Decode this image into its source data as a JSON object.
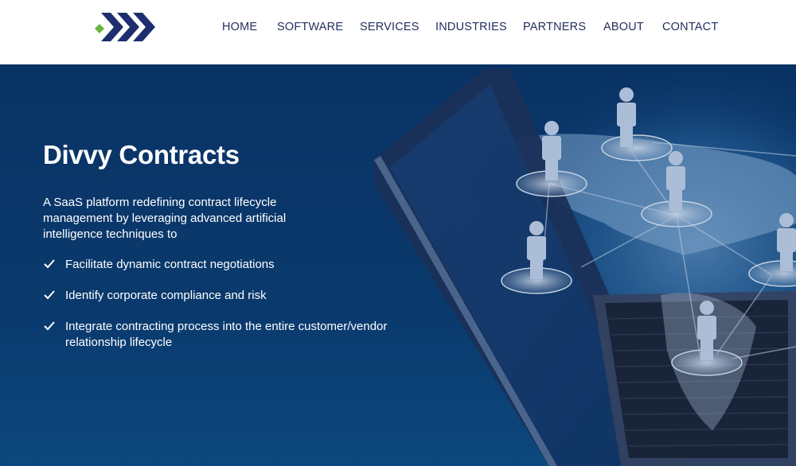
{
  "header": {
    "logo": {
      "name": "company-logo",
      "colors": {
        "chevrons": "#1f2e6e",
        "diamond": "#6cb33f"
      }
    },
    "nav": [
      {
        "label": "HOME"
      },
      {
        "label": "SOFTWARE"
      },
      {
        "label": "SERVICES"
      },
      {
        "label": "INDUSTRIES"
      },
      {
        "label": "PARTNERS"
      },
      {
        "label": "ABOUT"
      },
      {
        "label": "CONTACT"
      }
    ]
  },
  "hero": {
    "title": "Divvy Contracts",
    "description": "A SaaS platform redefining contract lifecycle management by leveraging advanced artificial intelligence techniques to",
    "bullets": [
      {
        "icon": "check-icon",
        "text": "Facilitate dynamic contract negotiations"
      },
      {
        "icon": "check-icon",
        "text": "Identify corporate compliance and risk"
      },
      {
        "icon": "check-icon",
        "text": "Integrate contracting process into the entire customer/vendor relationship lifecycle"
      }
    ],
    "image": "laptop-with-global-network-people-icons",
    "background_color": "#0b3a6e"
  }
}
